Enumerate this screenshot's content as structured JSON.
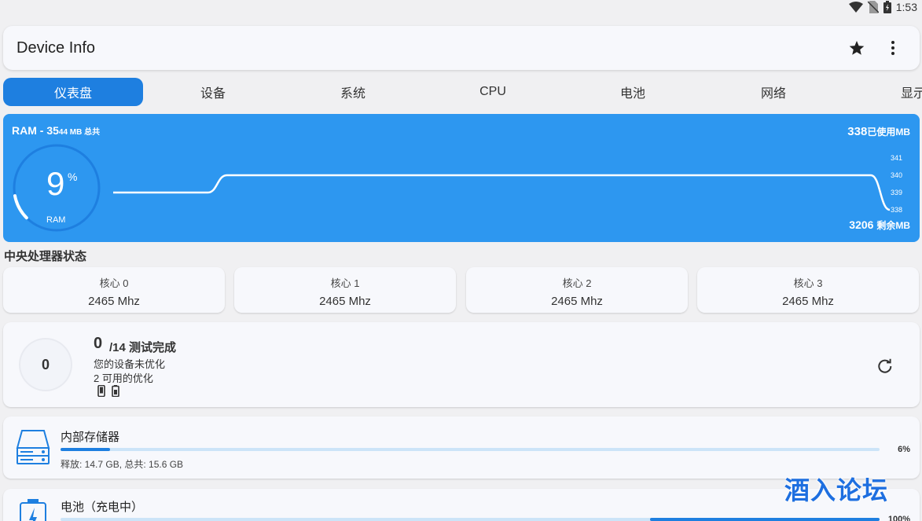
{
  "status_bar": {
    "time": "1:53"
  },
  "app": {
    "title": "Device Info"
  },
  "tabs": [
    "仪表盘",
    "设备",
    "系统",
    "CPU",
    "电池",
    "网络",
    "显示"
  ],
  "ram": {
    "title_prefix": "RAM - 35",
    "title_suffix": "44 MB 总共",
    "used_value": "338",
    "used_unit": "已使用MB",
    "free_value": "3206",
    "free_unit": "剩余MB",
    "percent": "9",
    "percent_sign": "%",
    "gauge_label": "RAM",
    "gauge_fraction": 0.095,
    "y_ticks": [
      "341",
      "340",
      "339",
      "338"
    ]
  },
  "chart_data": {
    "type": "line",
    "title": "",
    "xlabel": "",
    "ylabel": "",
    "ylim": [
      338,
      341
    ],
    "series": [
      {
        "values": [
          339,
          339,
          339,
          339,
          339,
          339,
          340,
          340,
          340,
          340,
          340,
          340,
          340,
          340,
          340,
          340,
          340,
          340,
          340,
          340,
          340,
          340,
          340,
          340,
          340,
          340,
          340,
          340,
          340,
          340,
          340,
          340,
          340,
          340,
          340,
          340,
          340,
          340,
          340,
          340,
          340,
          338
        ]
      }
    ]
  },
  "cpu": {
    "section_title": "中央处理器状态",
    "cores": [
      {
        "name": "核心 0",
        "freq": "2465 Mhz"
      },
      {
        "name": "核心 1",
        "freq": "2465 Mhz"
      },
      {
        "name": "核心 2",
        "freq": "2465 Mhz"
      },
      {
        "name": "核心 3",
        "freq": "2465 Mhz"
      }
    ]
  },
  "tests": {
    "score": "0",
    "count": "0",
    "total": "/14 测试完成",
    "line1": "您的设备未优化",
    "line2": "2 可用的优化"
  },
  "storage": {
    "title": "内部存储器",
    "percent": "6%",
    "fraction": 0.06,
    "detail": "释放: 14.7 GB,  总共: 15.6 GB"
  },
  "battery": {
    "title": "电池（充电中）",
    "percent": "100%",
    "fraction": 1.0
  },
  "watermark": "酒入论坛"
}
